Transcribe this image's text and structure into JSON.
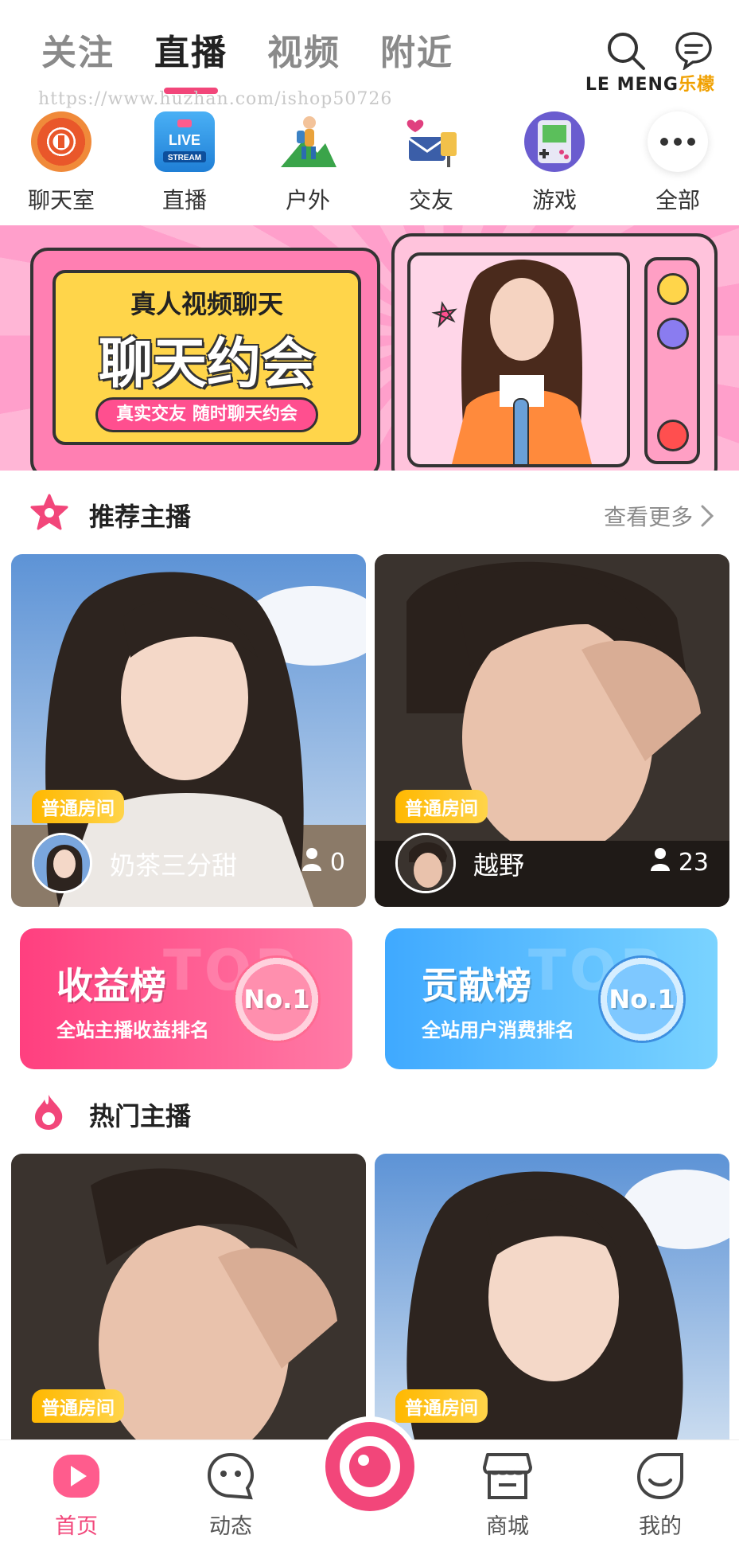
{
  "header": {
    "tabs": [
      {
        "label": "关注",
        "active": false
      },
      {
        "label": "直播",
        "active": true
      },
      {
        "label": "视频",
        "active": false
      },
      {
        "label": "附近",
        "active": false
      }
    ],
    "brand_latin": "LE MENG",
    "brand_cn": "乐檬",
    "watermark": "https://www.huzhan.com/ishop50726"
  },
  "categories": [
    {
      "label": "聊天室",
      "icon": "chat-room-icon"
    },
    {
      "label": "直播",
      "icon": "live-stream-icon"
    },
    {
      "label": "户外",
      "icon": "outdoor-icon"
    },
    {
      "label": "交友",
      "icon": "make-friends-icon"
    },
    {
      "label": "游戏",
      "icon": "game-icon"
    },
    {
      "label": "全部",
      "icon": "more-icon"
    }
  ],
  "banner": {
    "subtitle": "真人视频聊天",
    "title": "聊天约会",
    "pill": "真实交友 随时聊天约会",
    "slides": 2,
    "active_slide": 2,
    "live_badge_text": [
      "LIVE",
      "STREAM"
    ]
  },
  "recommended": {
    "title": "推荐主播",
    "see_more": "查看更多",
    "cards": [
      {
        "badge": "普通房间",
        "name": "奶茶三分甜",
        "viewers": "0"
      },
      {
        "badge": "普通房间",
        "name": "越野",
        "viewers": "23"
      }
    ]
  },
  "rankings": [
    {
      "title": "收益榜",
      "subtitle": "全站主播收益排名",
      "bg_word": "TOP",
      "medal": "No.1"
    },
    {
      "title": "贡献榜",
      "subtitle": "全站用户消费排名",
      "bg_word": "TOP",
      "medal": "No.1"
    }
  ],
  "hot": {
    "title": "热门主播",
    "cards": [
      {
        "badge": "普通房间"
      },
      {
        "badge": "普通房间"
      }
    ]
  },
  "tabbar": [
    {
      "label": "首页",
      "active": true
    },
    {
      "label": "动态",
      "active": false
    },
    {
      "label": "",
      "active": false
    },
    {
      "label": "商城",
      "active": false
    },
    {
      "label": "我的",
      "active": false
    }
  ],
  "colors": {
    "accent": "#f2467a",
    "badge": "#ffb800",
    "rank_pink": "#ff5c8d",
    "rank_blue": "#4fb5ff"
  }
}
